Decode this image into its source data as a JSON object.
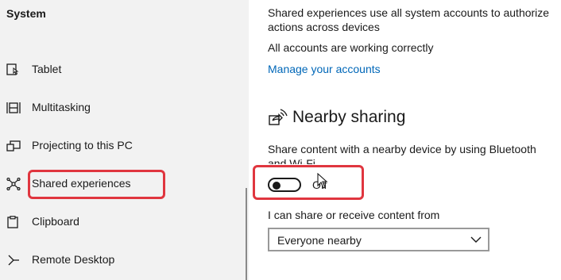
{
  "sidebar": {
    "title": "System",
    "items": [
      {
        "label": "Tablet",
        "icon": "tablet-icon"
      },
      {
        "label": "Multitasking",
        "icon": "multitasking-icon"
      },
      {
        "label": "Projecting to this PC",
        "icon": "projecting-icon"
      },
      {
        "label": "Shared experiences",
        "icon": "shared-experiences-icon"
      },
      {
        "label": "Clipboard",
        "icon": "clipboard-icon"
      },
      {
        "label": "Remote Desktop",
        "icon": "remote-desktop-icon"
      }
    ]
  },
  "content": {
    "shared_desc_line1": "Shared experiences use all system accounts to authorize",
    "shared_desc_line2": "actions across devices",
    "accounts_status": "All accounts are working correctly",
    "manage_link": "Manage your accounts",
    "nearby_title": "Nearby sharing",
    "nearby_desc_line1": "Share content with a nearby device by using Bluetooth",
    "nearby_desc_line2": "and Wi-Fi",
    "toggle_state": "Off",
    "share_from_label": "I can share or receive content from",
    "share_from_value": "Everyone nearby"
  },
  "colors": {
    "accent_link": "#0067b8",
    "highlight": "#e0363f",
    "sidebar_bg": "#f2f2f2"
  }
}
